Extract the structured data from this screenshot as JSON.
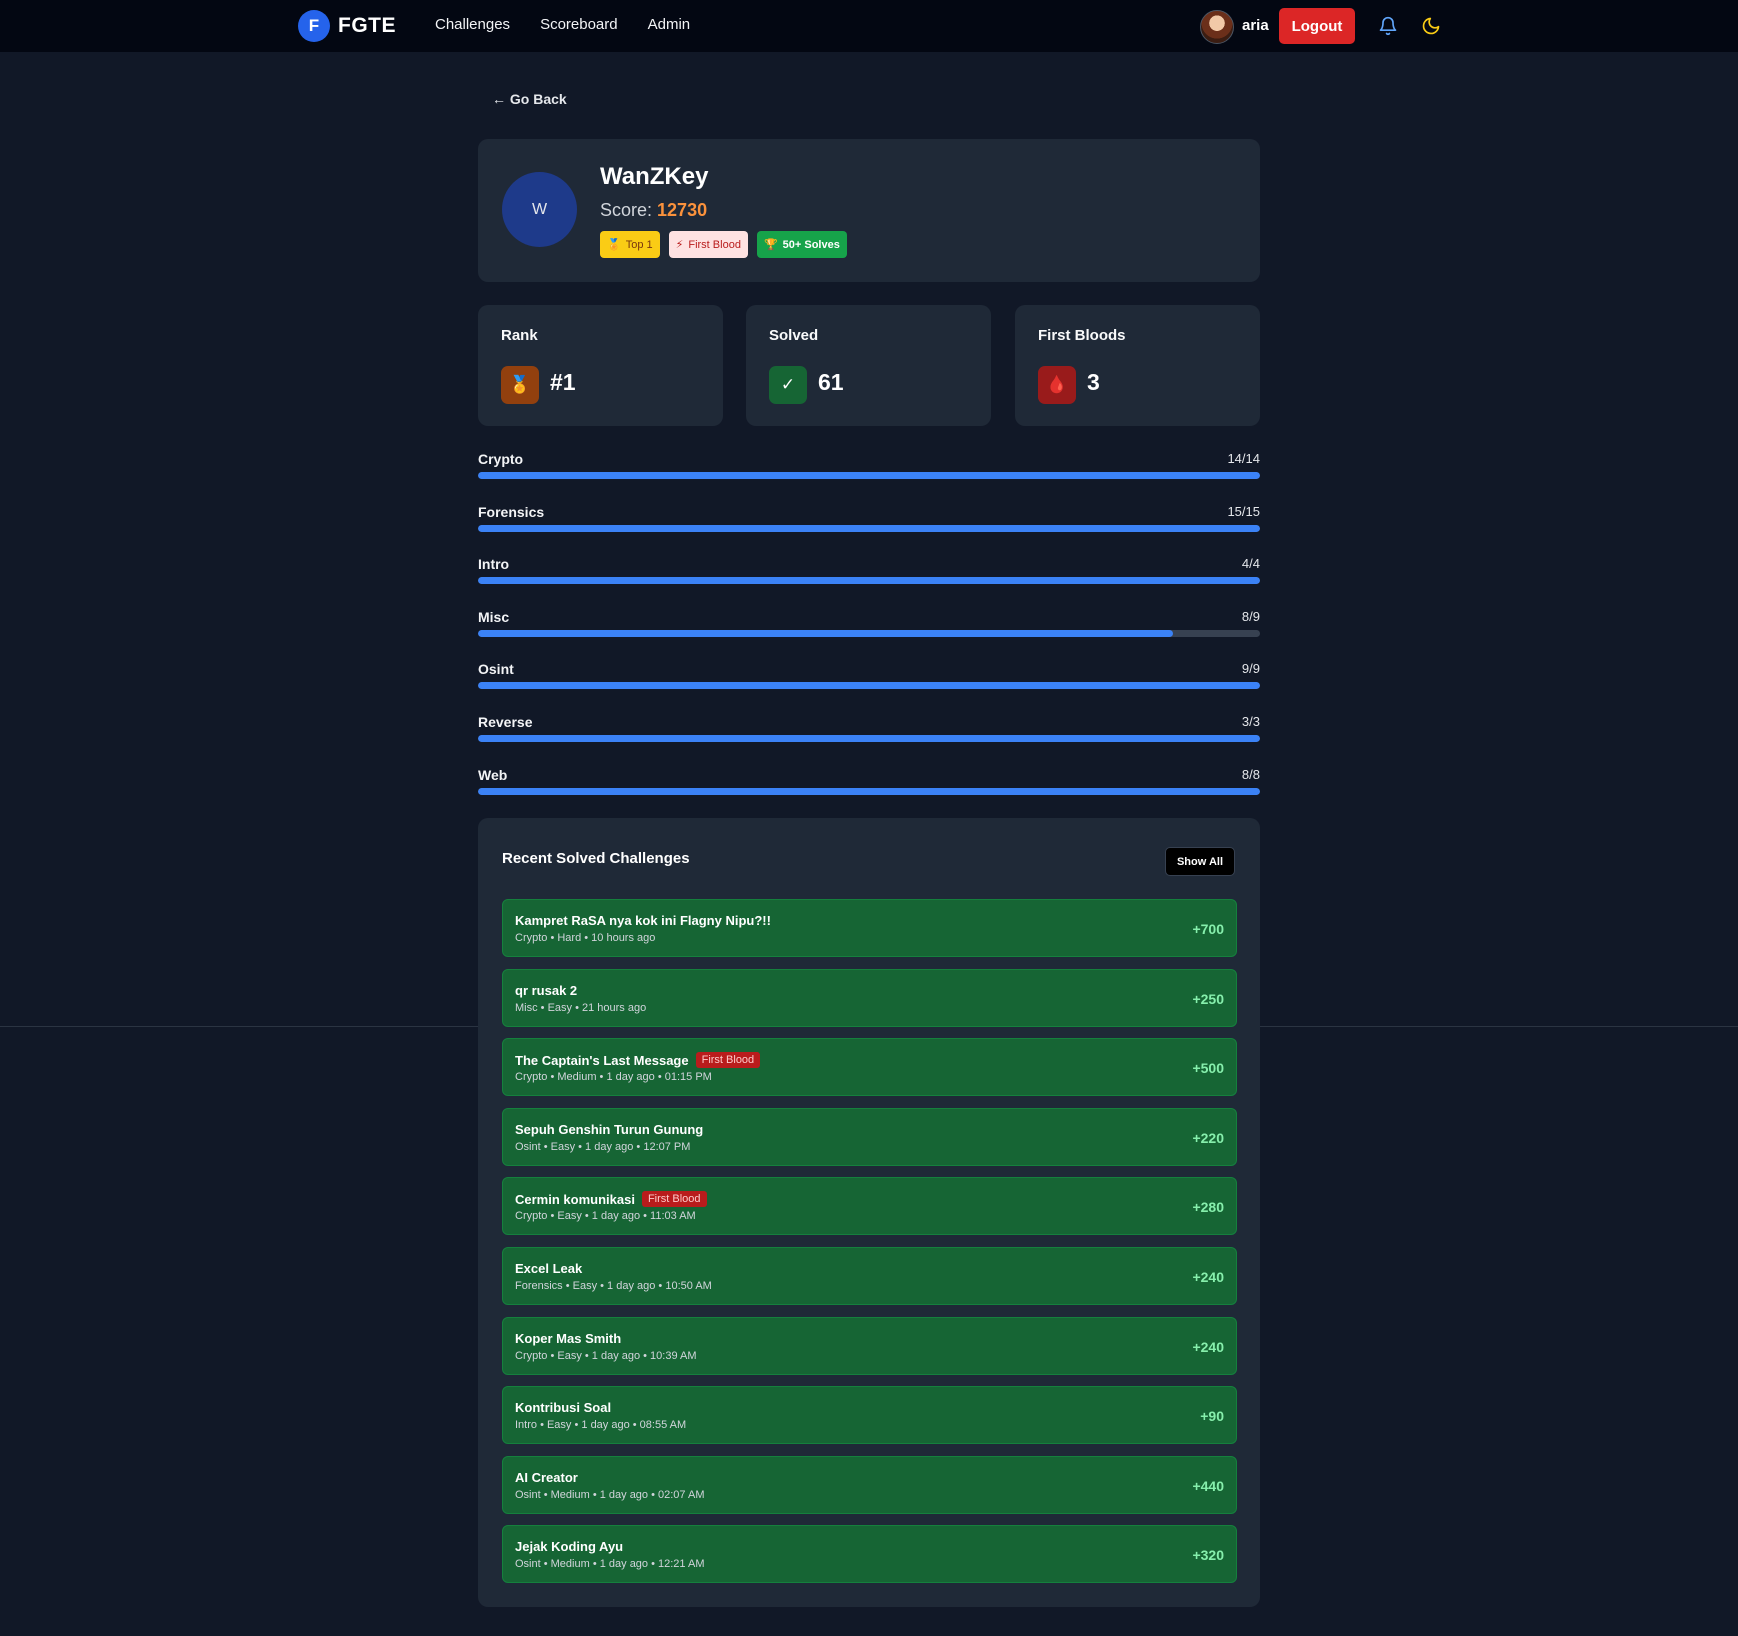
{
  "nav": {
    "logo_letter": "F",
    "brand": "FGTE",
    "links": [
      "Challenges",
      "Scoreboard",
      "Admin"
    ],
    "username": "aria",
    "logout_label": "Logout",
    "icons": [
      "bell-icon",
      "moon-icon"
    ]
  },
  "go_back_label": "← Go Back",
  "profile": {
    "avatar_letter": "W",
    "name": "WanZKey",
    "score_label": "Score:",
    "score": "12730",
    "badges": [
      {
        "icon": "🏅",
        "label": "Top 1"
      },
      {
        "icon": "⚡",
        "label": "First Blood"
      },
      {
        "icon": "🏆",
        "label": "50+ Solves"
      }
    ]
  },
  "stats": [
    {
      "label": "Rank",
      "value": "#1",
      "icon": "medal-icon",
      "icon_glyph": "🏅",
      "color": "#92400e"
    },
    {
      "label": "Solved",
      "value": "61",
      "icon": "check-icon",
      "icon_glyph": "✓",
      "color": "#166534"
    },
    {
      "label": "First Bloods",
      "value": "3",
      "icon": "blood-drop-icon",
      "icon_glyph": "🩸",
      "color": "#991b1b"
    }
  ],
  "categories": [
    {
      "name": "Crypto",
      "count": "14/14",
      "solved": 14,
      "total": 14
    },
    {
      "name": "Forensics",
      "count": "15/15",
      "solved": 15,
      "total": 15
    },
    {
      "name": "Intro",
      "count": "4/4",
      "solved": 4,
      "total": 4
    },
    {
      "name": "Misc",
      "count": "8/9",
      "solved": 8,
      "total": 9
    },
    {
      "name": "Osint",
      "count": "9/9",
      "solved": 9,
      "total": 9
    },
    {
      "name": "Reverse",
      "count": "3/3",
      "solved": 3,
      "total": 3
    },
    {
      "name": "Web",
      "count": "8/8",
      "solved": 8,
      "total": 8
    }
  ],
  "recent": {
    "title": "Recent Solved Challenges",
    "show_all_label": "Show All",
    "first_blood_label": "First Blood",
    "items": [
      {
        "title": "Kampret RaSA nya kok ini Flagny Nipu?!!",
        "meta": "Crypto • Hard • 10 hours ago",
        "points": "+700",
        "first_blood": false
      },
      {
        "title": "qr rusak 2",
        "meta": "Misc • Easy • 21 hours ago",
        "points": "+250",
        "first_blood": false
      },
      {
        "title": "The Captain's Last Message",
        "meta": "Crypto • Medium • 1 day ago • 01:15 PM",
        "points": "+500",
        "first_blood": true
      },
      {
        "title": "Sepuh Genshin Turun Gunung",
        "meta": "Osint • Easy • 1 day ago • 12:07 PM",
        "points": "+220",
        "first_blood": false
      },
      {
        "title": "Cermin komunikasi",
        "meta": "Crypto • Easy • 1 day ago • 11:03 AM",
        "points": "+280",
        "first_blood": true
      },
      {
        "title": "Excel Leak",
        "meta": "Forensics • Easy • 1 day ago • 10:50 AM",
        "points": "+240",
        "first_blood": false
      },
      {
        "title": "Koper Mas Smith",
        "meta": "Crypto • Easy • 1 day ago • 10:39 AM",
        "points": "+240",
        "first_blood": false
      },
      {
        "title": "Kontribusi Soal",
        "meta": "Intro • Easy • 1 day ago • 08:55 AM",
        "points": "+90",
        "first_blood": false
      },
      {
        "title": "AI Creator",
        "meta": "Osint • Medium • 1 day ago • 02:07 AM",
        "points": "+440",
        "first_blood": false
      },
      {
        "title": "Jejak Koding Ayu",
        "meta": "Osint • Medium • 1 day ago • 12:21 AM",
        "points": "+320",
        "first_blood": false
      }
    ]
  },
  "colors": {
    "accent": "#3b82f6",
    "score": "#fb923c",
    "solve_bg": "#166534",
    "logout": "#dc2626"
  }
}
